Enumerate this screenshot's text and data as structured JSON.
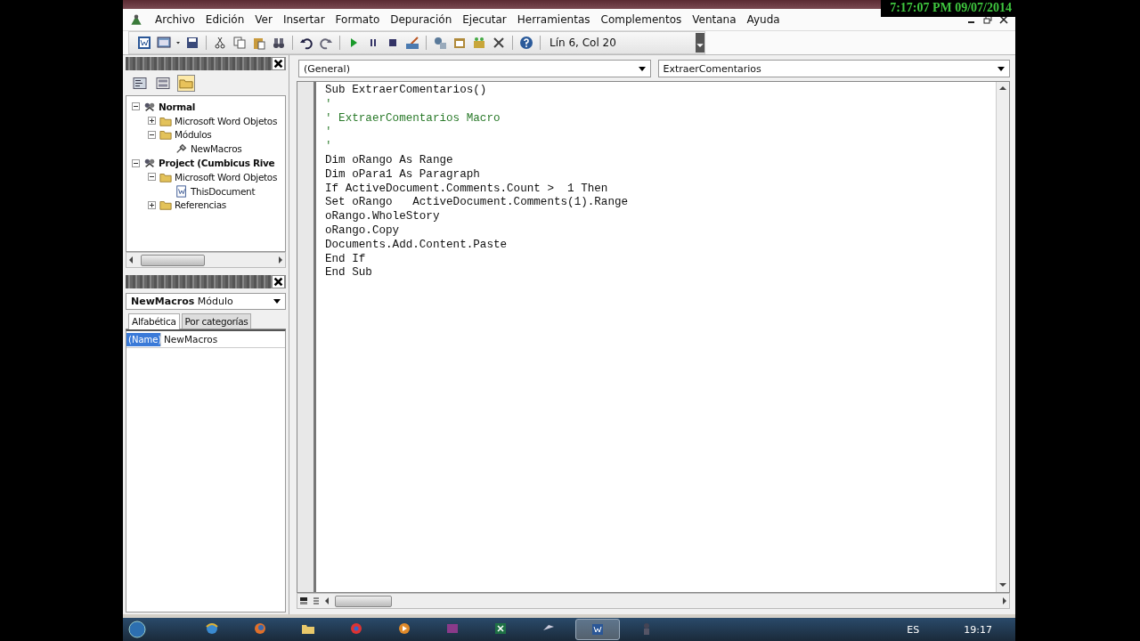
{
  "clock_overlay": "7:17:07 PM 09/07/2014",
  "menu_bar": [
    {
      "label": "Archivo"
    },
    {
      "label": "Edición"
    },
    {
      "label": "Ver"
    },
    {
      "label": "Insertar"
    },
    {
      "label": "Formato"
    },
    {
      "label": "Depuración"
    },
    {
      "label": "Ejecutar"
    },
    {
      "label": "Herramientas"
    },
    {
      "label": "Complementos"
    },
    {
      "label": "Ventana"
    },
    {
      "label": "Ayuda"
    }
  ],
  "toolbar": {
    "position": "Lín 6, Col 20"
  },
  "project_explorer": {
    "tree": [
      {
        "label": "Normal",
        "kind": "project",
        "expanded": true,
        "children": [
          {
            "label": "Microsoft Word Objetos",
            "kind": "folder",
            "expanded": false
          },
          {
            "label": "Módulos",
            "kind": "folder",
            "expanded": true,
            "children": [
              {
                "label": "NewMacros",
                "kind": "module"
              }
            ]
          }
        ]
      },
      {
        "label": "Project (Cumbicus Rive",
        "kind": "project",
        "expanded": true,
        "children": [
          {
            "label": "Microsoft Word Objetos",
            "kind": "folder",
            "expanded": true,
            "children": [
              {
                "label": "ThisDocument",
                "kind": "document"
              }
            ]
          },
          {
            "label": "Referencias",
            "kind": "folder",
            "expanded": false
          }
        ]
      }
    ]
  },
  "properties": {
    "object": "**NewMacros** Módulo",
    "tabs": [
      {
        "label": "Alfabética",
        "selected": true
      },
      {
        "label": "Por categorías",
        "selected": false
      }
    ],
    "rows": [
      {
        "name": "(Name)",
        "value": "NewMacros",
        "selected": true
      }
    ]
  },
  "code_window": {
    "object": "(General)",
    "procedure": "ExtraerComentarios",
    "lines": [
      {
        "kind": "code",
        "text": "Sub ExtraerComentarios()"
      },
      {
        "kind": "comment",
        "text": "'"
      },
      {
        "kind": "comment",
        "text": "' ExtraerComentarios Macro"
      },
      {
        "kind": "comment",
        "text": "'"
      },
      {
        "kind": "comment",
        "text": "'"
      },
      {
        "kind": "code",
        "text": "Dim oRango As Range"
      },
      {
        "kind": "code",
        "text": "Dim oPara1 As Paragraph"
      },
      {
        "kind": "code",
        "text": "If ActiveDocument.Comments.Count >  1 Then"
      },
      {
        "kind": "code",
        "text": "Set oRango   ActiveDocument.Comments(1).Range"
      },
      {
        "kind": "code",
        "text": "oRango.WholeStory"
      },
      {
        "kind": "code",
        "text": "oRango.Copy"
      },
      {
        "kind": "code",
        "text": "Documents.Add.Content.Paste"
      },
      {
        "kind": "code",
        "text": "End If"
      },
      {
        "kind": "code",
        "text": "End Sub"
      }
    ]
  },
  "taskbar": {
    "language": "ES",
    "time": "19:17"
  }
}
